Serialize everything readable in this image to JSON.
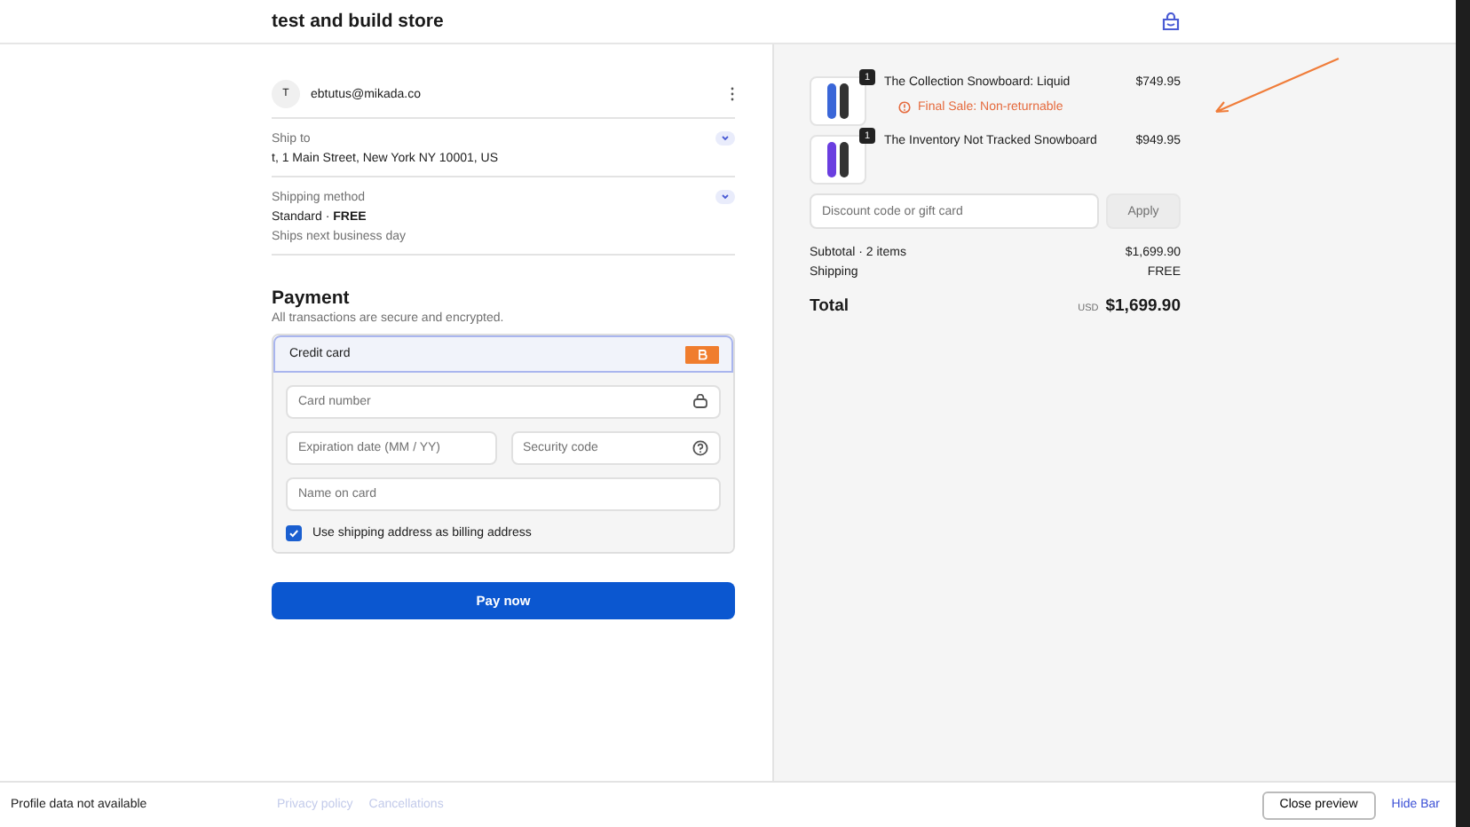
{
  "header": {
    "store_name": "test and build store"
  },
  "contact": {
    "avatar_initial": "T",
    "email": "ebtutus@mikada.co"
  },
  "ship_to": {
    "label": "Ship to",
    "value": "t, 1 Main Street, New York NY 10001, US"
  },
  "shipping_method": {
    "label": "Shipping method",
    "method": "Standard · **FREE**",
    "note": "Ships next business day"
  },
  "payment": {
    "title": "Payment",
    "subtitle": "All transactions are secure and encrypted.",
    "method_label": "Credit card",
    "fields": [
      {
        "placeholder": "Card number",
        "kind": "lock"
      },
      {
        "placeholder": "Expiration date (MM / YY)",
        "kind": "plain"
      },
      {
        "placeholder": "Security code",
        "kind": "help"
      },
      {
        "placeholder": "Name on card",
        "kind": "plain"
      }
    ],
    "billing_same": {
      "label": "Use shipping address as billing address",
      "checked": true
    },
    "pay_button": "Pay now"
  },
  "footer_links": [
    "Privacy policy",
    "Cancellations"
  ],
  "summary": {
    "items": [
      {
        "name": "The Collection Snowboard: Liquid",
        "price": "$749.95",
        "quantity": "1",
        "note": "Final Sale: Non-returnable",
        "color": "#3a66d8"
      },
      {
        "name": "The Inventory Not Tracked Snowboard",
        "price": "$949.95",
        "quantity": "1",
        "color": "#6a3ee0"
      }
    ],
    "discount_placeholder": "Discount code or gift card",
    "apply_button": "Apply",
    "subtotal_label": "Subtotal · 2 items",
    "subtotal": "$1,699.90",
    "shipping_label": "Shipping",
    "shipping": "FREE",
    "total_label": "Total",
    "currency": "USD",
    "total": "$1,699.90"
  },
  "preview_bar": {
    "message": "Profile data not available",
    "close_button": "Close preview",
    "hide_link": "Hide Bar"
  }
}
